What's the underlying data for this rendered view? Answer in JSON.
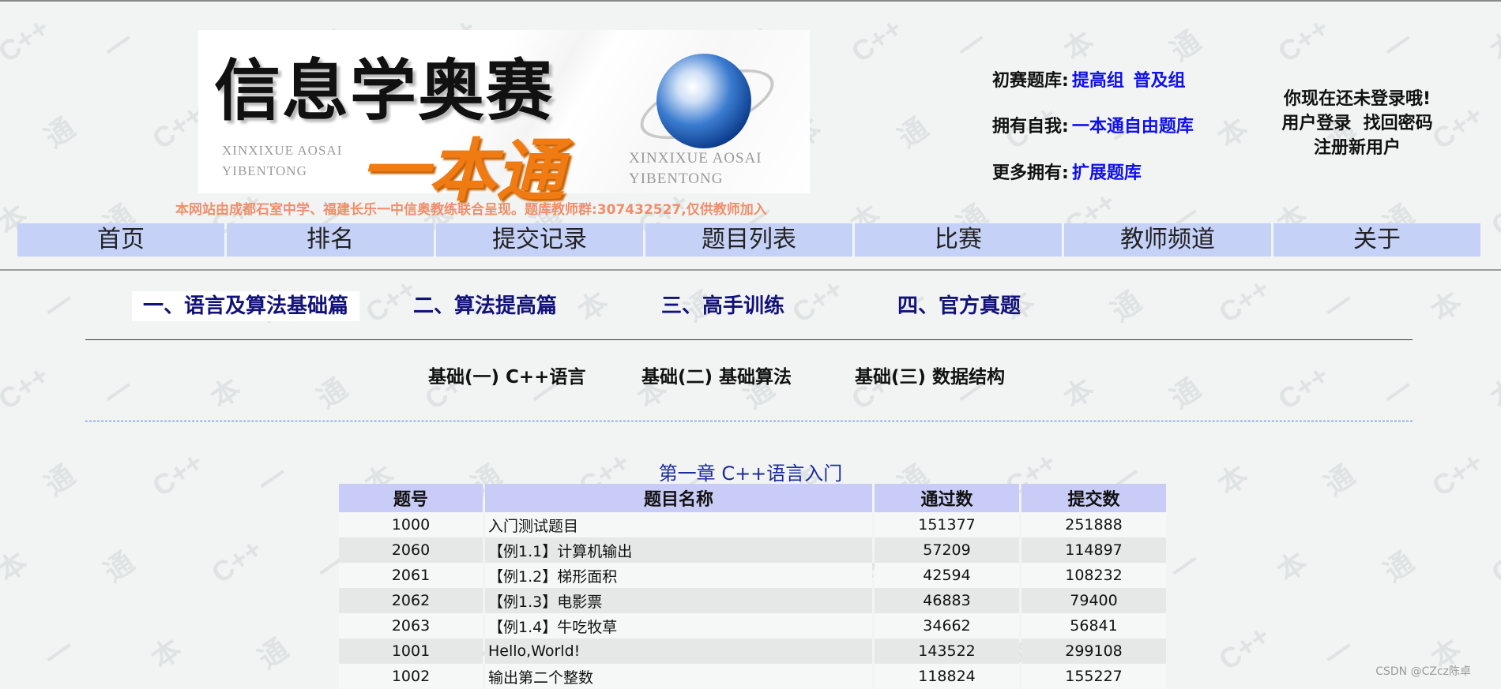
{
  "banner": {
    "title_cn": "信息学奥赛",
    "subtitle_cn": "一本通",
    "pinyin_left": "XINXIXUE AOSAI\nYIBENTONG",
    "pinyin_right": "XINXIXUE AOSAI\nYIBENTONG",
    "site_note": "本网站由成都石室中学、福建长乐一中信奥教练联合呈现。题库教师群:307432527,仅供教师加入"
  },
  "header_info": {
    "row1_label": "初赛题库:",
    "row1_links": [
      "提高组",
      "普及组"
    ],
    "row2_label": "拥有自我:",
    "row2_link": "一本通自由题库",
    "row3_label": "更多拥有:",
    "row3_link": "扩展题库"
  },
  "login": {
    "status": "你现在还未登录哦!",
    "login_link": "用户登录",
    "recover_link": "找回密码",
    "register_link": "注册新用户"
  },
  "nav": [
    "首页",
    "排名",
    "提交记录",
    "题目列表",
    "比赛",
    "教师频道",
    "关于"
  ],
  "section_tabs": [
    "一、语言及算法基础篇",
    "二、算法提高篇",
    "三、高手训练",
    "四、官方真题"
  ],
  "sub_tabs": [
    "基础(一) C++语言",
    "基础(二) 基础算法",
    "基础(三) 数据结构"
  ],
  "chapter_title": "第一章 C++语言入门",
  "table": {
    "headers": [
      "题号",
      "题目名称",
      "通过数",
      "提交数"
    ],
    "rows": [
      [
        "1000",
        "入门测试题目",
        "151377",
        "251888"
      ],
      [
        "2060",
        "【例1.1】计算机输出",
        "57209",
        "114897"
      ],
      [
        "2061",
        "【例1.2】梯形面积",
        "42594",
        "108232"
      ],
      [
        "2062",
        "【例1.3】电影票",
        "46883",
        "79400"
      ],
      [
        "2063",
        "【例1.4】牛吃牧草",
        "34662",
        "56841"
      ],
      [
        "1001",
        "Hello,World!",
        "143522",
        "299108"
      ],
      [
        "1002",
        "输出第二个整数",
        "118824",
        "155227"
      ]
    ]
  },
  "watermark": "CSDN @CZcz陈卓",
  "colors": {
    "nav_bg": "#c5d1f6",
    "table_header_bg": "#c9ccf6",
    "link": "#1010e8",
    "section_tab": "#12127a",
    "chapter": "#1a2aa0",
    "site_note": "#f08e6a"
  }
}
